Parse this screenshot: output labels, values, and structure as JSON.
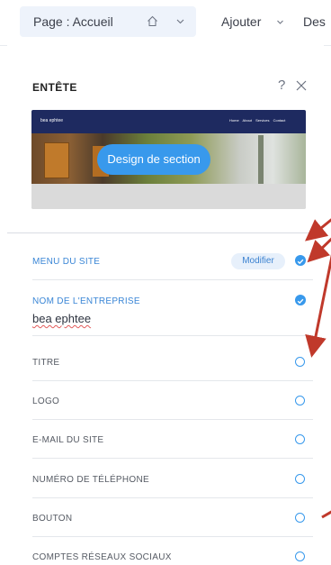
{
  "toolbar": {
    "page_label": "Page : Accueil",
    "add_label": "Ajouter",
    "design_label": "Des"
  },
  "panel": {
    "title": "ENTÊTE",
    "help": "?",
    "preview": {
      "site_name": "bea ephtee",
      "nav_links": "Home About Services Contact",
      "design_button": "Design de section"
    }
  },
  "rows": [
    {
      "label": "MENU DU SITE",
      "checked": true,
      "action": "Modifier"
    },
    {
      "label": "NOM DE L'ENTREPRISE",
      "checked": true,
      "value": "bea ephtee"
    },
    {
      "label": "TITRE",
      "checked": false
    },
    {
      "label": "LOGO",
      "checked": false
    },
    {
      "label": "E-MAIL DU SITE",
      "checked": false
    },
    {
      "label": "NUMÉRO DE TÉLÉPHONE",
      "checked": false
    },
    {
      "label": "BOUTON",
      "checked": false
    },
    {
      "label": "COMPTES RÉSEAUX SOCIAUX",
      "checked": false
    }
  ],
  "colors": {
    "accent": "#3899ec",
    "preview_nav": "#1e2a60",
    "annotation_arrows": "#c0392b"
  }
}
